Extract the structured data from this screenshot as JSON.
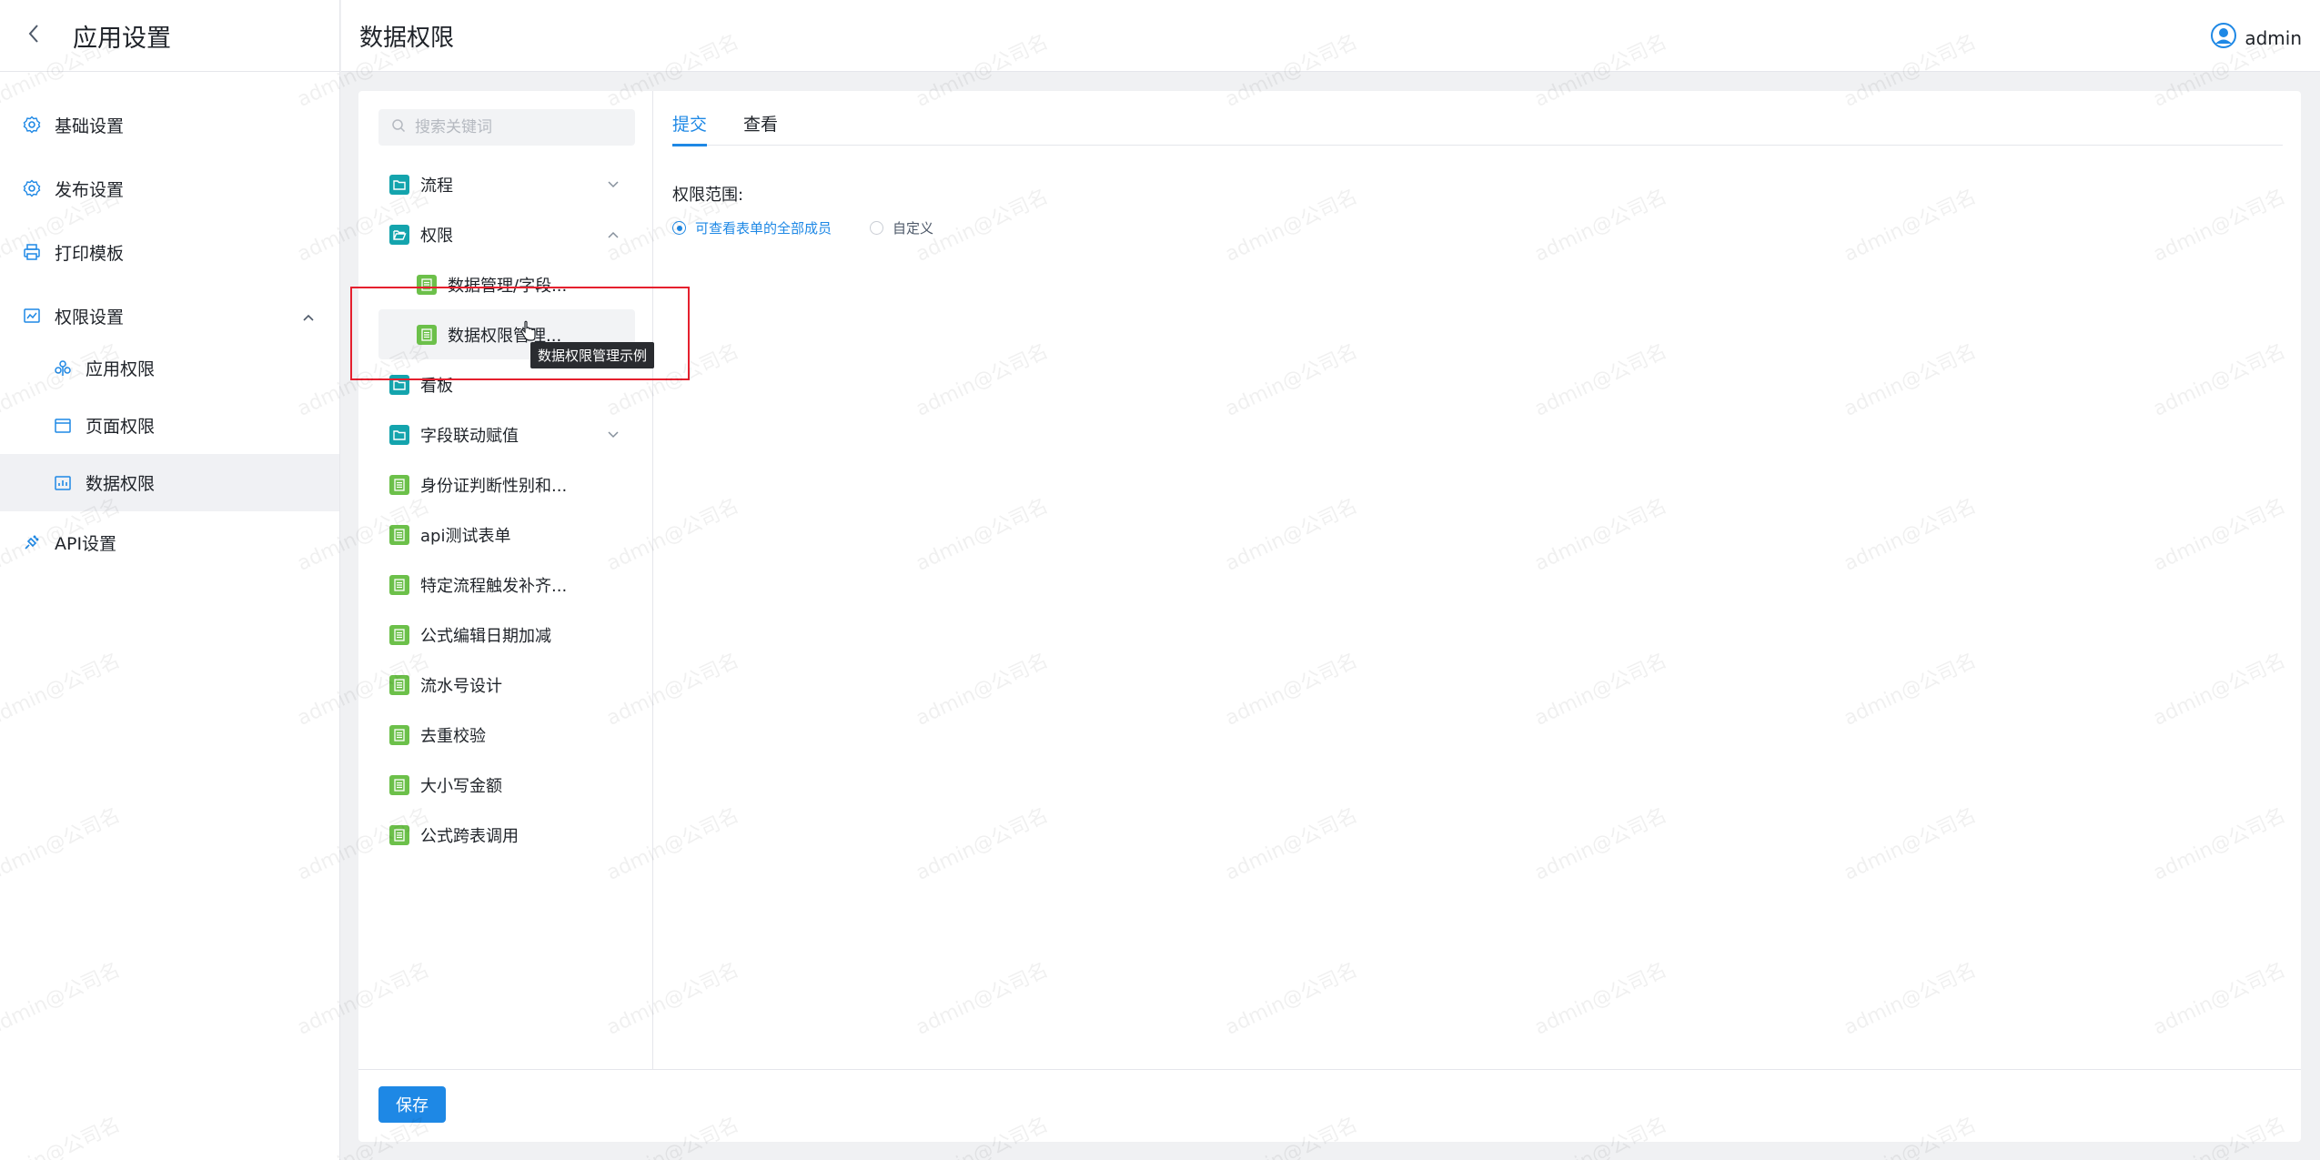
{
  "sidebar": {
    "title": "应用设置",
    "items": [
      {
        "label": "基础设置"
      },
      {
        "label": "发布设置"
      },
      {
        "label": "打印模板"
      },
      {
        "label": "权限设置"
      },
      {
        "label": "API设置"
      }
    ],
    "subitems": [
      {
        "label": "应用权限"
      },
      {
        "label": "页面权限"
      },
      {
        "label": "数据权限"
      }
    ]
  },
  "header": {
    "page_title": "数据权限",
    "username": "admin"
  },
  "tree": {
    "search_placeholder": "搜索关键词",
    "items": [
      {
        "label": "流程",
        "type": "folder"
      },
      {
        "label": "权限",
        "type": "folder-open"
      },
      {
        "label": "数据管理/字段...",
        "type": "form"
      },
      {
        "label": "数据权限管理...",
        "type": "form"
      },
      {
        "label": "看板",
        "type": "folder"
      },
      {
        "label": "字段联动赋值",
        "type": "folder"
      },
      {
        "label": "身份证判断性别和...",
        "type": "form"
      },
      {
        "label": "api测试表单",
        "type": "form"
      },
      {
        "label": "特定流程触发补齐...",
        "type": "form"
      },
      {
        "label": "公式编辑日期加减",
        "type": "form"
      },
      {
        "label": "流水号设计",
        "type": "form"
      },
      {
        "label": "去重校验",
        "type": "form"
      },
      {
        "label": "大小写金额",
        "type": "form"
      },
      {
        "label": "公式跨表调用",
        "type": "form"
      }
    ],
    "tooltip": "数据权限管理示例"
  },
  "panel": {
    "tabs": [
      {
        "label": "提交"
      },
      {
        "label": "查看"
      }
    ],
    "perm_label": "权限范围:",
    "radio_all": "可查看表单的全部成员",
    "radio_custom": "自定义"
  },
  "footer": {
    "save_label": "保存"
  },
  "watermark": "admin@公司名",
  "colors": {
    "accent": "#1e88e5",
    "folder": "#14a4ad",
    "form": "#6cc04a",
    "highlight": "#e5202e"
  }
}
